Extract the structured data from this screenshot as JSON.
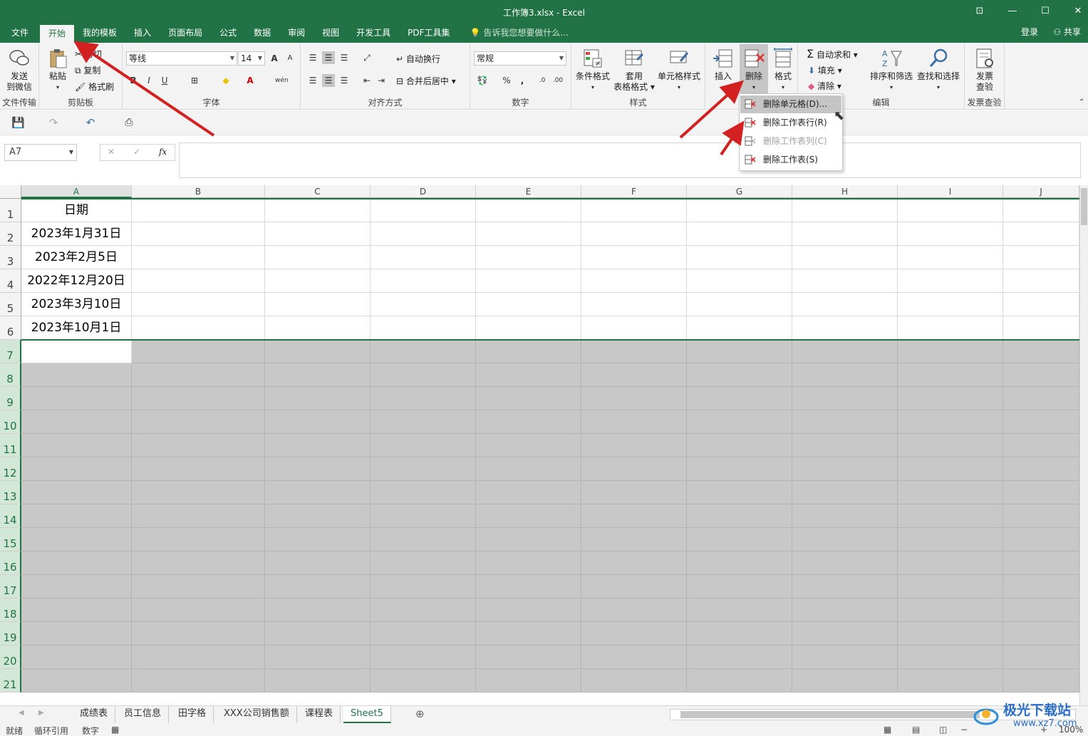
{
  "window": {
    "title": "工作簿3.xlsx - Excel",
    "restore_icon": "ribbon-display-icon"
  },
  "tabs": [
    "文件",
    "开始",
    "我的模板",
    "插入",
    "页面布局",
    "公式",
    "数据",
    "审阅",
    "视图",
    "开发工具",
    "PDF工具集"
  ],
  "active_tab": "开始",
  "tell_me": "告诉我您想要做什么...",
  "login": "登录",
  "share": "共享",
  "ribbon": {
    "wechat": {
      "label1": "发送",
      "label2": "到微信",
      "group": "文件传输"
    },
    "clipboard": {
      "paste": "粘贴",
      "cut": "剪切",
      "copy": "复制",
      "painter": "格式刷",
      "group": "剪贴板"
    },
    "font": {
      "name": "等线",
      "size": "14",
      "group": "字体",
      "bold": "B",
      "italic": "I",
      "underline": "U",
      "grow": "A",
      "shrink": "A"
    },
    "align": {
      "wrap": "自动换行",
      "merge": "合并后居中",
      "group": "对齐方式"
    },
    "number": {
      "format": "常规",
      "group": "数字",
      "percent": "%",
      "comma": ","
    },
    "styles": {
      "cond": "条件格式",
      "table1": "套用",
      "table2": "表格格式",
      "cell": "单元格样式",
      "group": "样式"
    },
    "cells": {
      "insert": "插入",
      "delete": "删除",
      "format": "格式"
    },
    "editing": {
      "autosum": "自动求和",
      "fill": "填充",
      "clear": "清除",
      "sort": "排序和筛选",
      "find": "查找和选择",
      "group": "编辑"
    },
    "invoice": {
      "label1": "发票",
      "label2": "查验",
      "group": "发票查验"
    }
  },
  "name_box": "A7",
  "fx": "fx",
  "columns": [
    "A",
    "B",
    "C",
    "D",
    "E",
    "F",
    "G",
    "H",
    "I",
    "J"
  ],
  "rows": [
    "1",
    "2",
    "3",
    "4",
    "5",
    "6",
    "7",
    "8",
    "9",
    "10",
    "11",
    "12",
    "13",
    "14",
    "15",
    "16",
    "17",
    "18",
    "19",
    "20",
    "21"
  ],
  "cells_A": [
    "日期",
    "2023年1月31日",
    "2023年2月5日",
    "2022年12月20日",
    "2023年3月10日",
    "2023年10月1日"
  ],
  "delete_menu": [
    {
      "label": "删除单元格(D)...",
      "state": "hover"
    },
    {
      "label": "删除工作表行(R)",
      "state": "normal"
    },
    {
      "label": "删除工作表列(C)",
      "state": "disabled"
    },
    {
      "label": "删除工作表(S)",
      "state": "normal"
    }
  ],
  "sheets": [
    "成绩表",
    "员工信息",
    "田字格",
    "XXX公司销售额",
    "课程表",
    "Sheet5"
  ],
  "active_sheet": "Sheet5",
  "status": {
    "ready": "就绪",
    "circular": "循环引用",
    "num": "数字",
    "zoom": "100%"
  },
  "watermark": {
    "text": "极光下载站",
    "url": "www.xz7.com"
  },
  "colors": {
    "excel_green": "#217346",
    "shade": "#c8c8c8",
    "arrow": "#d32020"
  }
}
